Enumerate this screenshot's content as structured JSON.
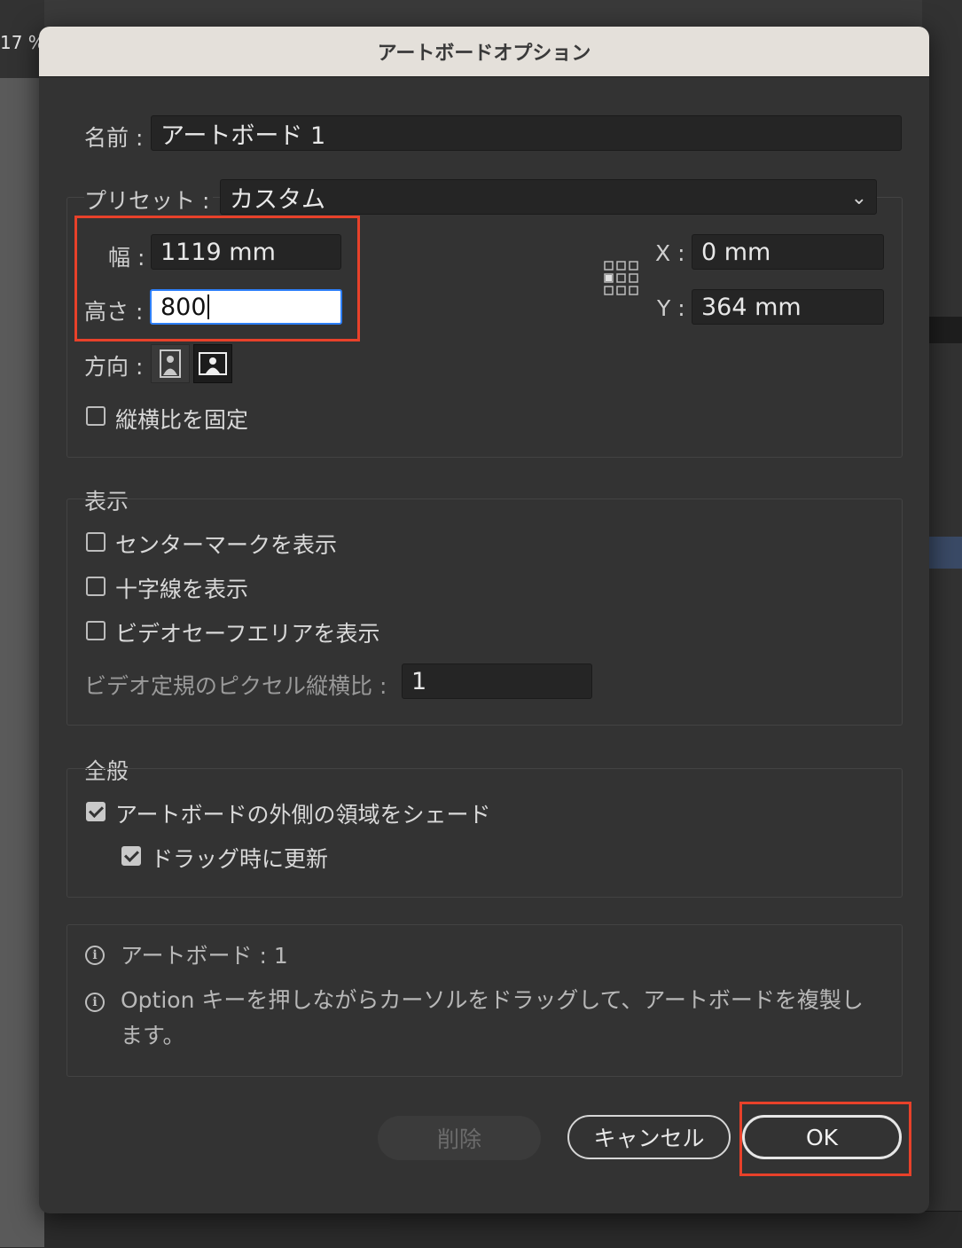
{
  "background": {
    "zoom_text": "17 %"
  },
  "dialog": {
    "title": "アートボードオプション",
    "name": {
      "label": "名前 :",
      "value": "アートボード 1"
    },
    "preset": {
      "label": "プリセット :",
      "value": "カスタム"
    },
    "width": {
      "label": "幅 :",
      "value": "1119 mm"
    },
    "height": {
      "label": "高さ :",
      "value": "800"
    },
    "x": {
      "label": "X :",
      "value": "0 mm"
    },
    "y": {
      "label": "Y :",
      "value": "364 mm"
    },
    "orientation": {
      "label": "方向 :",
      "selected": "landscape"
    },
    "constrain": {
      "label": "縦横比を固定",
      "checked": false
    },
    "display": {
      "heading": "表示",
      "center_mark": {
        "label": "センターマークを表示",
        "checked": false
      },
      "crosshair": {
        "label": "十字線を表示",
        "checked": false
      },
      "video_safe": {
        "label": "ビデオセーフエリアを表示",
        "checked": false
      },
      "pixel_ratio": {
        "label": "ビデオ定規のピクセル縦横比 :",
        "value": "1"
      }
    },
    "general": {
      "heading": "全般",
      "shade_outside": {
        "label": "アートボードの外側の領域をシェード",
        "checked": true
      },
      "update_drag": {
        "label": "ドラッグ時に更新",
        "checked": true
      }
    },
    "info": {
      "count": "アートボード : 1",
      "hint": "Option キーを押しながらカーソルをドラッグして、アートボードを複製します。"
    },
    "buttons": {
      "delete": "削除",
      "cancel": "キャンセル",
      "ok": "OK"
    }
  },
  "colors": {
    "highlight": "#e8412a",
    "focus": "#2d7ff9"
  }
}
